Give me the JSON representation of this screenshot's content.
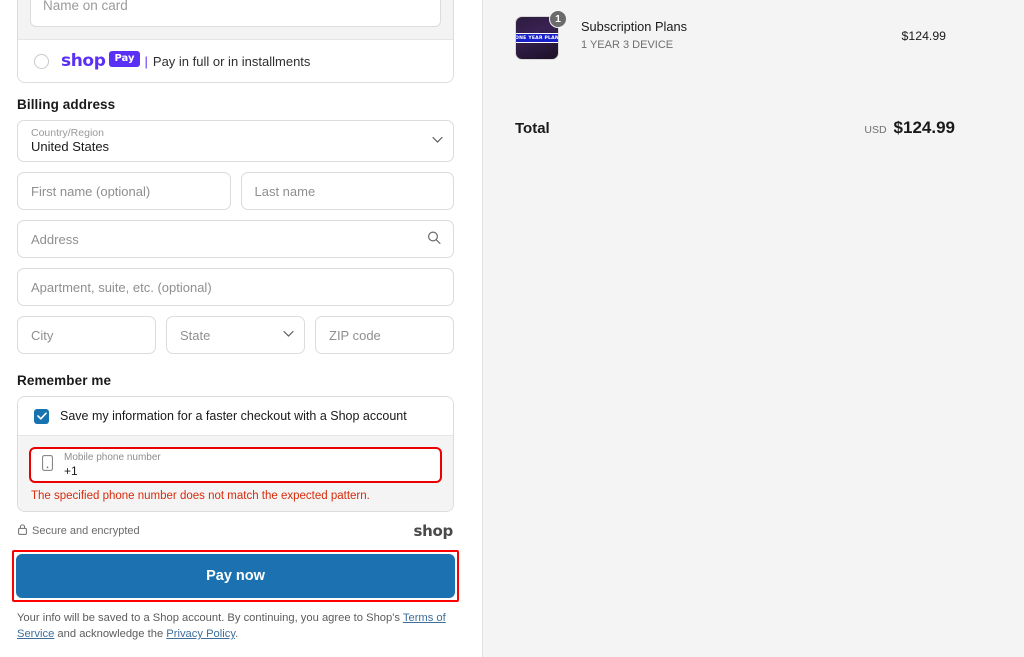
{
  "payment": {
    "name_on_card_placeholder": "Name on card",
    "shop_pay": {
      "brand": "shop",
      "pill": "Pay",
      "separator": "|",
      "tagline": "Pay in full or in installments"
    }
  },
  "billing": {
    "heading": "Billing address",
    "country": {
      "label": "Country/Region",
      "value": "United States"
    },
    "first_name_placeholder": "First name (optional)",
    "last_name_placeholder": "Last name",
    "address_placeholder": "Address",
    "apartment_placeholder": "Apartment, suite, etc. (optional)",
    "city_placeholder": "City",
    "state_placeholder": "State",
    "zip_placeholder": "ZIP code"
  },
  "remember": {
    "heading": "Remember me",
    "checkbox_label": "Save my information for a faster checkout with a Shop account",
    "checkbox_checked": true,
    "phone": {
      "label": "Mobile phone number",
      "value": "+1"
    },
    "error": "The specified phone number does not match the expected pattern.",
    "error_color": "#d72c0d"
  },
  "footer": {
    "secure_text": "Secure and encrypted",
    "shop_logo": "shop",
    "pay_now_label": "Pay now",
    "pay_now_color": "#1c72b0",
    "highlight_color": "#ff0000",
    "legal_prefix": "Your info will be saved to a Shop account. By continuing, you agree to Shop's ",
    "terms_link": "Terms of Service",
    "legal_middle": " and acknowledge the ",
    "privacy_link": "Privacy Policy",
    "legal_suffix": "."
  },
  "summary": {
    "items": [
      {
        "title": "Subscription Plans",
        "variant": "1 YEAR 3 DEVICE",
        "price": "$124.99",
        "quantity": "1",
        "thumbnail_badge": "ONE YEAR PLAN"
      }
    ],
    "total_label": "Total",
    "total_currency": "USD",
    "total_amount": "$124.99"
  }
}
